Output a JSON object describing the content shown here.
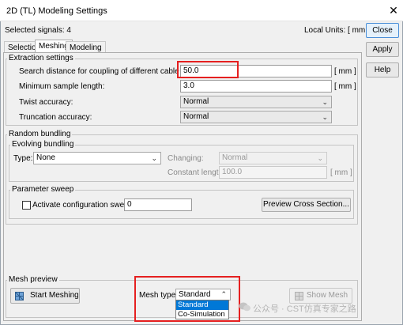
{
  "window": {
    "title": "2D (TL) Modeling Settings",
    "close_glyph": "✕"
  },
  "header": {
    "selected_signals": "Selected signals: 4",
    "local_units": "Local Units: [ mm ]"
  },
  "side_buttons": {
    "close": "Close",
    "apply": "Apply",
    "help": "Help"
  },
  "tabs": [
    {
      "label": "Selection"
    },
    {
      "label": "Meshing"
    },
    {
      "label": "Modeling"
    }
  ],
  "extraction": {
    "title": "Extraction settings",
    "search_distance_label": "Search distance for coupling of different cable bundles:",
    "search_distance_value": "50.0",
    "search_distance_unit": "[ mm ]",
    "min_sample_label": "Minimum sample length:",
    "min_sample_value": "3.0",
    "min_sample_unit": "[ mm ]",
    "twist_label": "Twist accuracy:",
    "twist_value": "Normal",
    "truncation_label": "Truncation accuracy:",
    "truncation_value": "Normal"
  },
  "random_bundling": {
    "title": "Random bundling",
    "evolving_title": "Evolving bundling",
    "type_label": "Type:",
    "type_value": "None",
    "changing_label": "Changing:",
    "changing_value": "Normal",
    "constant_length_label": "Constant length:",
    "constant_length_value": "100.0",
    "constant_length_unit": "[ mm ]"
  },
  "parameter_sweep": {
    "title": "Parameter sweep",
    "activate_label": "Activate configuration sweep",
    "activate_checked": false,
    "value": "0",
    "preview_button": "Preview Cross Section..."
  },
  "mesh_preview": {
    "title": "Mesh preview",
    "start_button": "Start Meshing",
    "mesh_type_label": "Mesh type:",
    "mesh_type_value": "Standard",
    "mesh_type_options": [
      "Standard",
      "Co-Simulation"
    ],
    "show_mesh_button": "Show Mesh"
  },
  "watermark": "公众号 · CST仿真专家之路",
  "colors": {
    "highlight_red": "#e52020",
    "selection_blue": "#0078d7",
    "default_button_border": "#4a8fd8"
  },
  "icons": [
    "close-x-icon",
    "chevron-down-icon",
    "mesh-icon",
    "wechat-icon"
  ]
}
